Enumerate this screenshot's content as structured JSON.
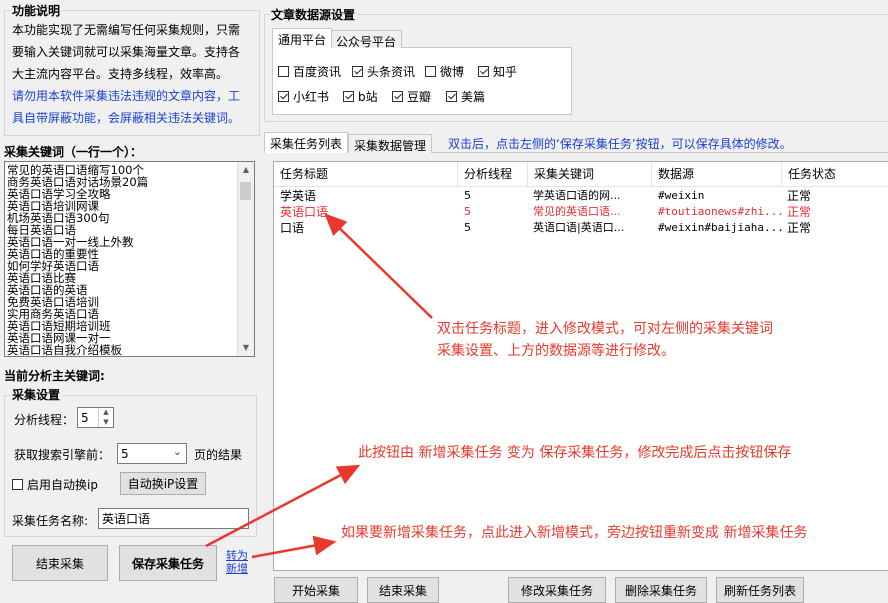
{
  "feature": {
    "title": "功能说明",
    "line1": "本功能实现了无需编写任何采集规则，只需",
    "line2": "要输入关键词就可以采集海量文章。支持各",
    "line3": "大主流内容平台。支持多线程，效率高。",
    "warn1": "请勿用本软件采集违法违规的文章内容，工",
    "warn2": "具自带屏蔽功能，会屏蔽相关违法关键词。"
  },
  "keywords": {
    "title": "采集关键词（一行一个）：",
    "items": [
      "常见的英语口语缩写100个",
      "商务英语口语对话场景20篇",
      "英语口语学习全攻略",
      "英语口语培训网课",
      "机场英语口语300句",
      "每日英语口语",
      "英语口语一对一线上外教",
      "英语口语的重要性",
      "如何学好英语口语",
      "英语口语比赛",
      "英语口语的英语",
      "免费英语口语培训",
      "实用商务英语口语",
      "英语口语短期培训班",
      "英语口语网课一对一",
      "英语口语自我介绍模板"
    ]
  },
  "current_kw_label": "当前分析主关键词:",
  "settings": {
    "title": "采集设置",
    "threads_label": "分析线程：",
    "threads_value": "5",
    "engine_label": "获取搜索引擎前：",
    "engine_value": "5",
    "engine_suffix": "页的结果",
    "auto_ip_label": "启用自动换ip",
    "auto_ip_btn": "自动换iP设置",
    "task_name_label": "采集任务名称:",
    "task_name_value": "英语口语"
  },
  "buttons": {
    "stop": "结束采集",
    "save": "保存采集任务",
    "switch_line1": "转为",
    "switch_line2": "新增",
    "bottom_start": "开始采集",
    "bottom_stop": "结束采集",
    "bottom_edit": "修改采集任务",
    "bottom_delete": "删除采集任务",
    "bottom_refresh": "刷新任务列表"
  },
  "source": {
    "title": "文章数据源设置",
    "tab_general": "通用平台",
    "tab_wechat": "公众号平台",
    "options": [
      {
        "label": "百度资讯",
        "checked": false
      },
      {
        "label": "头条资讯",
        "checked": true
      },
      {
        "label": "微博",
        "checked": false
      },
      {
        "label": "知乎",
        "checked": true
      },
      {
        "label": "小红书",
        "checked": true
      },
      {
        "label": "b站",
        "checked": true
      },
      {
        "label": "豆瓣",
        "checked": true
      },
      {
        "label": "美篇",
        "checked": true
      }
    ]
  },
  "tasks": {
    "tab_list": "采集任务列表",
    "tab_manage": "采集数据管理",
    "hint": "双击后，点击左侧的‘保存采集任务’按钮，可以保存具体的修改。",
    "columns": [
      "任务标题",
      "分析线程",
      "采集关键词",
      "数据源",
      "任务状态"
    ],
    "rows": [
      {
        "title": "学英语",
        "threads": "5",
        "keyword": "学英语口语的网...",
        "source": "#weixin",
        "status": "正常",
        "highlight": false
      },
      {
        "title": "英语口语",
        "threads": "5",
        "keyword": "常见的英语口语...",
        "source": "#toutiaonews#zhi...",
        "status": "正常",
        "highlight": true
      },
      {
        "title": "口语",
        "threads": "5",
        "keyword": "英语口语|英语口...",
        "source": "#weixin#baijiaha...",
        "status": "正常",
        "highlight": false
      }
    ]
  },
  "annotations": {
    "a1_line1": "双击任务标题，进入修改模式，可对左侧的采集关键词",
    "a1_line2": "采集设置、上方的数据源等进行修改。",
    "a2": "此按钮由 新增采集任务 变为 保存采集任务，修改完成后点击按钮保存",
    "a3": "如果要新增采集任务，点此进入新增模式，旁边按钮重新变成 新增采集任务"
  },
  "colors": {
    "highlight_red": "#e82c2c",
    "link_blue": "#1a3fd1",
    "annotation_red": "#e8392c"
  }
}
